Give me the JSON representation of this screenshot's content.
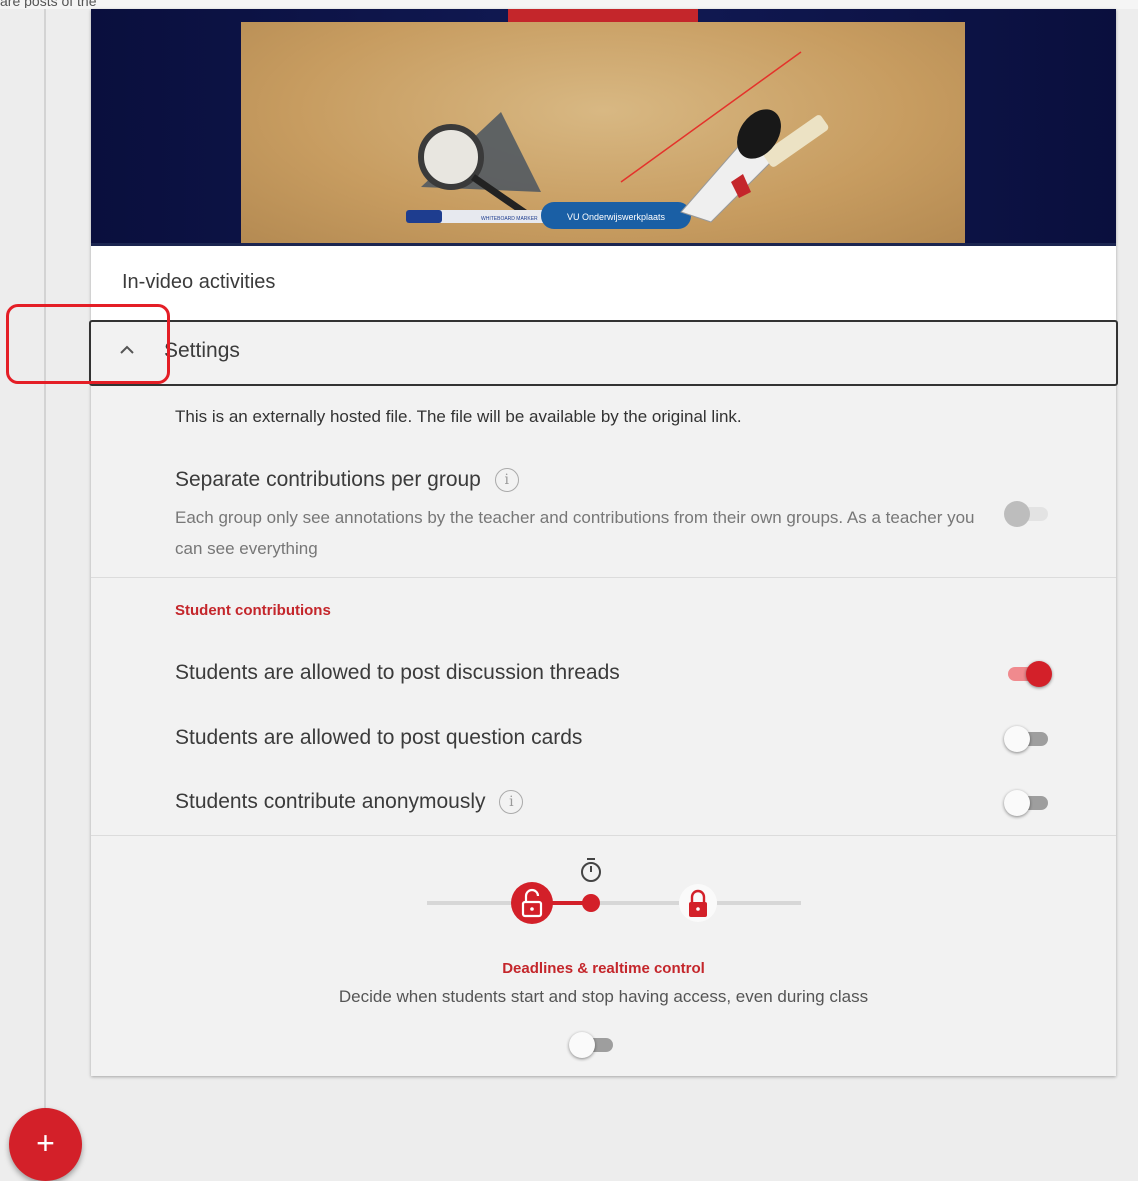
{
  "top_partial_text": "are posts of the",
  "video": {
    "badge_text": "VU Onderwijswerkplaats",
    "marker_text": "WHITEBOARD MARKER"
  },
  "card_title": "In-video activities",
  "settings": {
    "label": "Settings",
    "expanded": true,
    "external_note": "This is an externally hosted file. The file will be available by the original link.",
    "separate_groups": {
      "title": "Separate contributions per group",
      "description": "Each group only see annotations by the teacher and contributions from their own groups. As a teacher you can see everything",
      "enabled": false,
      "disabled": true
    },
    "student_contributions": {
      "heading": "Student contributions",
      "items": [
        {
          "label": "Students are allowed to post discussion threads",
          "enabled": true
        },
        {
          "label": "Students are allowed to post question cards",
          "enabled": false
        },
        {
          "label": "Students contribute anonymously",
          "enabled": false,
          "info": true
        }
      ]
    },
    "deadlines": {
      "title": "Deadlines & realtime control",
      "description": "Decide when students start and stop having access, even during class",
      "enabled": false
    }
  },
  "colors": {
    "accent": "#d32029",
    "highlight": "#e41e26"
  },
  "icons": [
    "chevron-up-icon",
    "info-icon",
    "stopwatch-icon",
    "unlock-icon",
    "lock-icon",
    "plus-icon"
  ],
  "fab_symbol": "+"
}
